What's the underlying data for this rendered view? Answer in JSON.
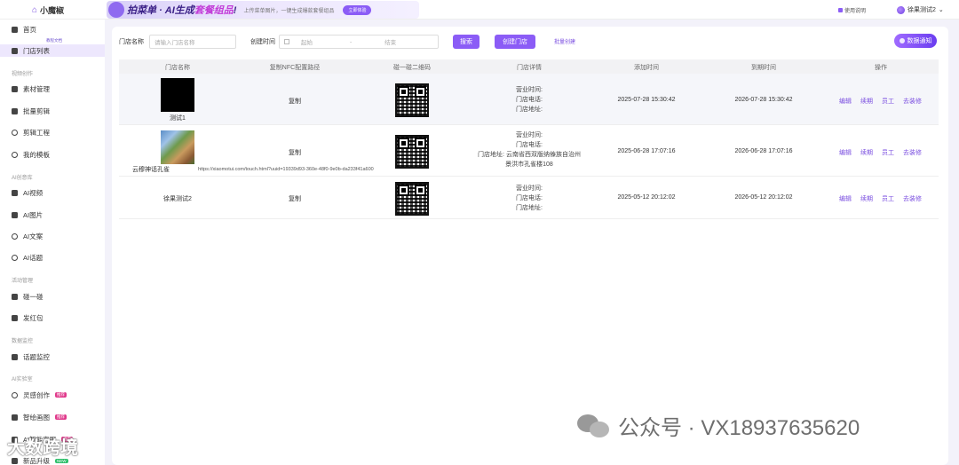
{
  "app": {
    "logo_text": "小魔椒"
  },
  "banner": {
    "title_pre": "拍菜单 · AI生成",
    "title_highlight": "套餐组品",
    "title_post": "!",
    "subtitle": "上传菜单图片，一键生成爆款套餐组品",
    "button": "立即体验"
  },
  "header": {
    "help": "使用说明",
    "user_name": "徐果测试2"
  },
  "sidebar": {
    "badge_float": "教程文档",
    "items": [
      {
        "label": "首页",
        "icon": "home-icon"
      },
      {
        "label": "门店列表",
        "icon": "store-list-icon",
        "active": true
      }
    ],
    "sections": [
      {
        "title": "视频创作",
        "items": [
          {
            "label": "素材管理",
            "icon": "material-icon"
          },
          {
            "label": "批量剪辑",
            "icon": "batch-edit-icon"
          },
          {
            "label": "剪辑工程",
            "icon": "edit-project-icon"
          },
          {
            "label": "我的模板",
            "icon": "template-icon"
          }
        ]
      },
      {
        "title": "AI创意库",
        "items": [
          {
            "label": "AI视频",
            "icon": "ai-video-icon"
          },
          {
            "label": "AI图片",
            "icon": "ai-image-icon"
          },
          {
            "label": "AI文案",
            "icon": "ai-copy-icon"
          },
          {
            "label": "AI话题",
            "icon": "ai-topic-icon"
          }
        ]
      },
      {
        "title": "活动管理",
        "items": [
          {
            "label": "碰一碰",
            "icon": "nfc-tap-icon"
          },
          {
            "label": "发红包",
            "icon": "red-packet-icon"
          }
        ]
      },
      {
        "title": "数据监控",
        "items": [
          {
            "label": "话题监控",
            "icon": "topic-monitor-icon"
          }
        ]
      },
      {
        "title": "AI实验室",
        "items": [
          {
            "label": "灵感创作",
            "icon": "inspiration-icon",
            "tag": "推荐"
          },
          {
            "label": "智绘画图",
            "icon": "ai-draw-icon",
            "tag": "推荐"
          },
          {
            "label": "AI智能客服",
            "icon": "ai-service-icon",
            "tag": "推荐"
          },
          {
            "label": "新品升级",
            "icon": "upgrade-icon",
            "tag_new": "NEW"
          }
        ]
      }
    ]
  },
  "filters": {
    "store_label": "门店名称",
    "store_placeholder": "请输入门店名称",
    "time_label": "创建时间",
    "start_placeholder": "起始",
    "separator": "-",
    "end_placeholder": "结束",
    "search_button": "搜索",
    "create_button": "创建门店",
    "batch_link": "批量创建",
    "notify_button": "数据通知"
  },
  "table": {
    "headers": [
      "门店名称",
      "复制NFC配置路径",
      "碰一碰二维码",
      "门店详情",
      "添加时间",
      "到期时间",
      "操作"
    ],
    "rows": [
      {
        "name": "测试1",
        "copy": "复制",
        "detail": [
          "营业时间:",
          "门店电话:",
          "门店地址:"
        ],
        "added": "2025-07-28 15:30:42",
        "expires": "2026-07-28 15:30:42",
        "ops": [
          "编辑",
          "续期",
          "员工",
          "去装修"
        ]
      },
      {
        "name": "云穆神话孔雀",
        "url": "https://xiaomotui.com/touch.html?uuid=19339d93-360e-48f0-9e0b-da233f41a600",
        "copy": "复制",
        "detail": [
          "营业时间:",
          "门店电话:",
          "门店地址: 云南省西双版纳傣族自治州",
          "景洪市孔雀楼108"
        ],
        "added": "2025-06-28 17:07:16",
        "expires": "2026-06-28 17:07:16",
        "ops": [
          "编辑",
          "续期",
          "员工",
          "去装修"
        ]
      },
      {
        "name": "徐果测试2",
        "copy": "复制",
        "detail": [
          "营业时间:",
          "门店电话:",
          "门店地址:"
        ],
        "added": "2025-05-12 20:12:02",
        "expires": "2026-05-12 20:12:02",
        "ops": [
          "编辑",
          "续期",
          "员工",
          "去装修"
        ]
      }
    ]
  },
  "watermark": {
    "text": "公众号 · VX18937635620",
    "secondary": "大数跨境"
  },
  "colors": {
    "accent": "#8b5cf6",
    "link": "#7b4fe0",
    "active_bg": "#ede7fd"
  }
}
